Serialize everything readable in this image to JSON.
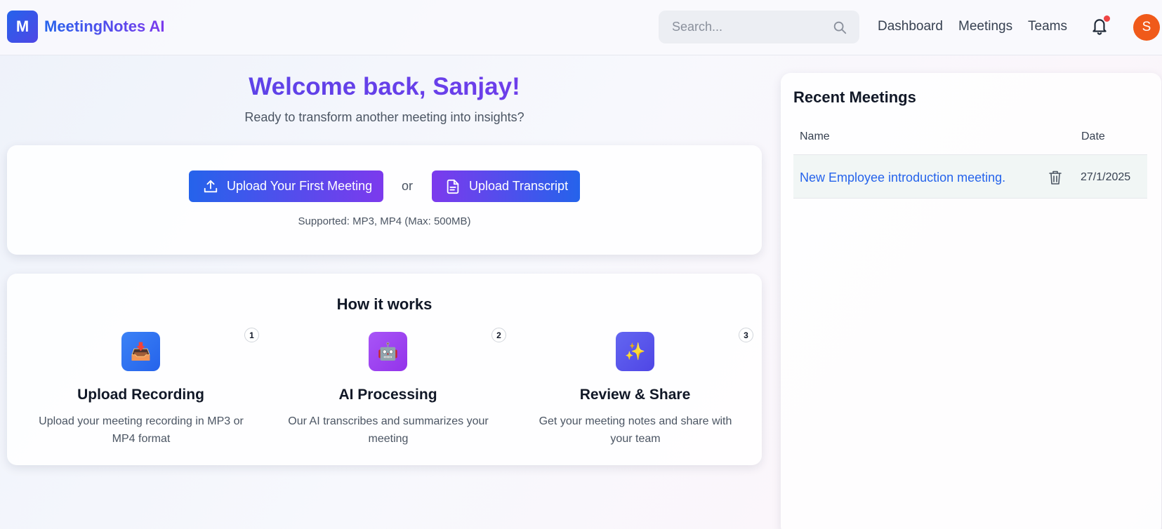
{
  "brand": {
    "logo_letter": "M",
    "name": "MeetingNotes AI"
  },
  "header": {
    "search_placeholder": "Search...",
    "nav": [
      "Dashboard",
      "Meetings",
      "Teams"
    ],
    "notification_dot_color": "#ef4444",
    "avatar_initial": "S",
    "avatar_color": "#f05a1a"
  },
  "hero": {
    "title": "Welcome back, Sanjay!",
    "subtitle": "Ready to transform another meeting into insights?"
  },
  "upload": {
    "upload_meeting_label": "Upload Your First Meeting",
    "or_label": "or",
    "upload_transcript_label": "Upload Transcript",
    "supported_text": "Supported: MP3, MP4 (Max: 500MB)"
  },
  "how_it_works": {
    "title": "How it works",
    "steps": [
      {
        "number": "1",
        "icon": "inbox-tray-icon",
        "title": "Upload Recording",
        "description": "Upload your meeting recording in MP3 or MP4 format"
      },
      {
        "number": "2",
        "icon": "robot-icon",
        "title": "AI Processing",
        "description": "Our AI transcribes and summarizes your meeting"
      },
      {
        "number": "3",
        "icon": "sparkles-icon",
        "title": "Review & Share",
        "description": "Get your meeting notes and share with your team"
      }
    ]
  },
  "recent_meetings": {
    "title": "Recent Meetings",
    "columns": [
      "Name",
      "Date"
    ],
    "rows": [
      {
        "name": "New Employee introduction meeting.",
        "date": "27/1/2025"
      }
    ]
  },
  "colors": {
    "primary": "#2563eb",
    "accent": "#7c3aed"
  }
}
